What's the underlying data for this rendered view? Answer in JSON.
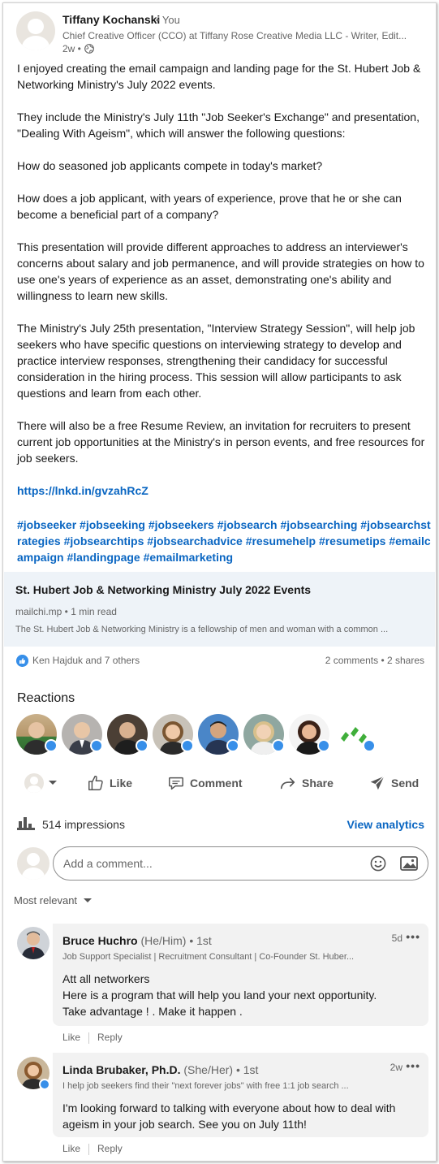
{
  "post": {
    "author_name": "Tiffany Kochanski",
    "author_relation": "• You",
    "author_headline": "Chief Creative Officer (CCO) at Tiffany Rose Creative Media LLC - Writer, Edit...",
    "time": "2w •",
    "paragraphs": [
      "I enjoyed creating the email campaign and landing page for the St. Hubert Job & Networking Ministry's July 2022 events.",
      "They include the Ministry's July 11th \"Job Seeker's Exchange\" and presentation, \"Dealing With Ageism\", which will answer the following questions:",
      "How do seasoned job applicants compete in today's market?",
      "How does a job applicant, with years of experience, prove that he or she can become a beneficial part of a company?",
      "This presentation will provide different approaches to address an interviewer's concerns about salary and job permanence, and will provide strategies on how to use one's years of experience as an asset, demonstrating one's ability and willingness to learn new skills.",
      "The Ministry's July 25th presentation, \"Interview Strategy Session\", will help job seekers who have specific questions on interviewing strategy to develop and practice interview responses, strengthening their candidacy for successful consideration in the hiring process. This session will allow participants to ask questions and learn from each other.",
      "There will also be a free Resume Review, an invitation for recruiters to present current job opportunities at the Ministry's in person events, and free resources for job seekers."
    ],
    "link": "https://lnkd.in/gvzahRcZ",
    "hashtags": "#jobseeker #jobseeking #jobseekers #jobsearch #jobsearching #jobsearchstrategies #jobsearchtips #jobsearchadvice #resumehelp #resumetips #emailcampaign #landingpage #emailmarketing"
  },
  "preview": {
    "title": "St. Hubert Job & Networking Ministry July 2022 Events",
    "meta": "mailchi.mp • 1 min read",
    "description": "The St. Hubert Job & Networking Ministry is a fellowship of men and woman with a common ..."
  },
  "social": {
    "reactors": "Ken Hajduk and 7 others",
    "counts": "2 comments • 2 shares"
  },
  "reactions": {
    "title": "Reactions"
  },
  "actions": {
    "like": "Like",
    "comment": "Comment",
    "share": "Share",
    "send": "Send"
  },
  "analytics": {
    "impressions": "514 impressions",
    "view_label": "View analytics"
  },
  "comment_input": {
    "placeholder": "Add a comment..."
  },
  "sort": {
    "label": "Most relevant"
  },
  "comments": [
    {
      "name": "Bruce Huchro",
      "pronouns": "(He/Him)",
      "degree": "• 1st",
      "headline": "Job Support Specialist | Recruitment Consultant | Co-Founder St. Huber...",
      "time": "5d",
      "more": "•••",
      "lines": [
        "Att all networkers",
        "Here is a program that will help you land your next opportunity.",
        "Take advantage ! . Make it happen ."
      ],
      "like": "Like",
      "reply": "Reply"
    },
    {
      "name": "Linda Brubaker, Ph.D.",
      "pronouns": "(She/Her)",
      "degree": "• 1st",
      "headline": "I help job seekers find their \"next forever jobs\" with free 1:1 job search ...",
      "time": "2w",
      "more": "•••",
      "lines": [
        "I'm looking forward to talking with everyone about how to deal with ageism in your job search. See you on July 11th!"
      ],
      "like": "Like",
      "reply": "Reply"
    }
  ],
  "colors": {
    "link_blue": "#0a66c2",
    "like_blue": "#378fe9",
    "preview_bg": "#eef3f8",
    "comment_bg": "#f2f2f2"
  }
}
